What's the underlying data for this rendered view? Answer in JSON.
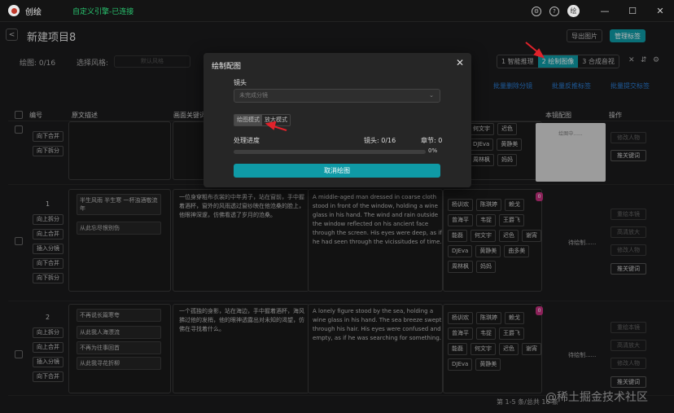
{
  "titlebar": {
    "app_name": "创绘",
    "status": "自定义引擎-已连接",
    "avatar": "绘",
    "minimize": "—",
    "maximize": "☐",
    "close": "✕"
  },
  "header": {
    "back": "<",
    "title": "新建项目8",
    "export_label": "导出图片",
    "tags_label": "管理标签"
  },
  "toolbar": {
    "draw_label": "绘图: 0/16",
    "style_label": "选择风格:",
    "style_placeholder": "默认风格",
    "steps": [
      "1 智能推理",
      "2 绘制图像",
      "3 合成音视"
    ],
    "active_step": 1
  },
  "links": {
    "one": "批量删除分镜",
    "two": "批量反推标签",
    "three": "批量提交标签"
  },
  "table": {
    "headers": [
      "编号",
      "原文描述",
      "画面关键词",
      "本镜配图",
      "操作"
    ],
    "row_actions": [
      "向上拆分",
      "向上合并",
      "插入分镜",
      "向下合并",
      "向下拆分"
    ],
    "top_actions": [
      "向下合并",
      "向下拆分"
    ],
    "ops": [
      "重绘本镜",
      "高清放大",
      "修改人物",
      "推关键词"
    ],
    "preview_text": "绘图中......",
    "pending": "待绘制......",
    "rows": [
      {
        "num": "1",
        "segments": [
          "半生风雨 半生寒 一杯浊酒敬流年",
          "从此忘尽恨别伤"
        ],
        "cn": "一位身穿粗布衣裳的中年男子，站在窗前，手中握着酒杯，窗外的风雨透过窗纱映在他沧桑的脸上，他眼神深邃，仿佛看透了岁月的沧桑。",
        "en": "A middle-aged man dressed in coarse cloth stood in front of the window, holding a wine glass in his hand. The wind and rain outside the window reflected on his ancient face through the screen. His eyes were deep, as if he had seen through the vicissitudes of time.",
        "tags": [
          "杨训欢",
          "陈琪婷",
          "赖戈",
          "曾海平",
          "韦捉",
          "王爵飞",
          "能磊",
          "何文宇",
          "迟色",
          "谢宵",
          "DJEva",
          "黄静美",
          "曲多美",
          "周林枫",
          "妈妈"
        ],
        "badge": "0"
      },
      {
        "num": "2",
        "segments": [
          "不再说长篇寒夸",
          "从此我人海漂流",
          "不再为往事回首",
          "从此我寻花折柳"
        ],
        "cn": "一个孤独的身影，站在海边，手中握着酒杯，海风拂过他的发梢，他的眼神透露出对未知的渴望，仿佛在寻找着什么。",
        "en": "A lonely figure stood by the sea, holding a wine glass in his hand. The sea breeze swept through his hair. His eyes were confused and empty, as if he was searching for something.",
        "tags": [
          "杨训欢",
          "陈琪婷",
          "赖戈",
          "曾海平",
          "韦捉",
          "王爵飞",
          "能磊",
          "何文宇",
          "迟色",
          "谢宵",
          "DJEva",
          "黄静美"
        ],
        "badge": "0"
      }
    ],
    "top_tags": [
      "何文宇",
      "迟色",
      "DJEva",
      "黄静美",
      "周林枫",
      "妈妈"
    ]
  },
  "pager": "第 1-5 条/总共 16 条",
  "watermark": "@稀土掘金技术社区",
  "modal": {
    "title": "绘制配图",
    "close": "✕",
    "shot_label": "镜头",
    "shot_placeholder": "未完成分镜",
    "tabs": [
      "绘图模式",
      "放大模式"
    ],
    "progress_label": "处理进度",
    "shots_progress": "镜头: 0/16",
    "chapter_progress": "章节: 0",
    "percent_label": "0%",
    "progress": 0.0,
    "cancel_label": "取消绘图"
  },
  "colors": {
    "accent": "#0f9aa6",
    "status": "#29c46f",
    "link": "#2a7cd3",
    "badge": "#c2307d",
    "arrow": "#e0222b"
  }
}
